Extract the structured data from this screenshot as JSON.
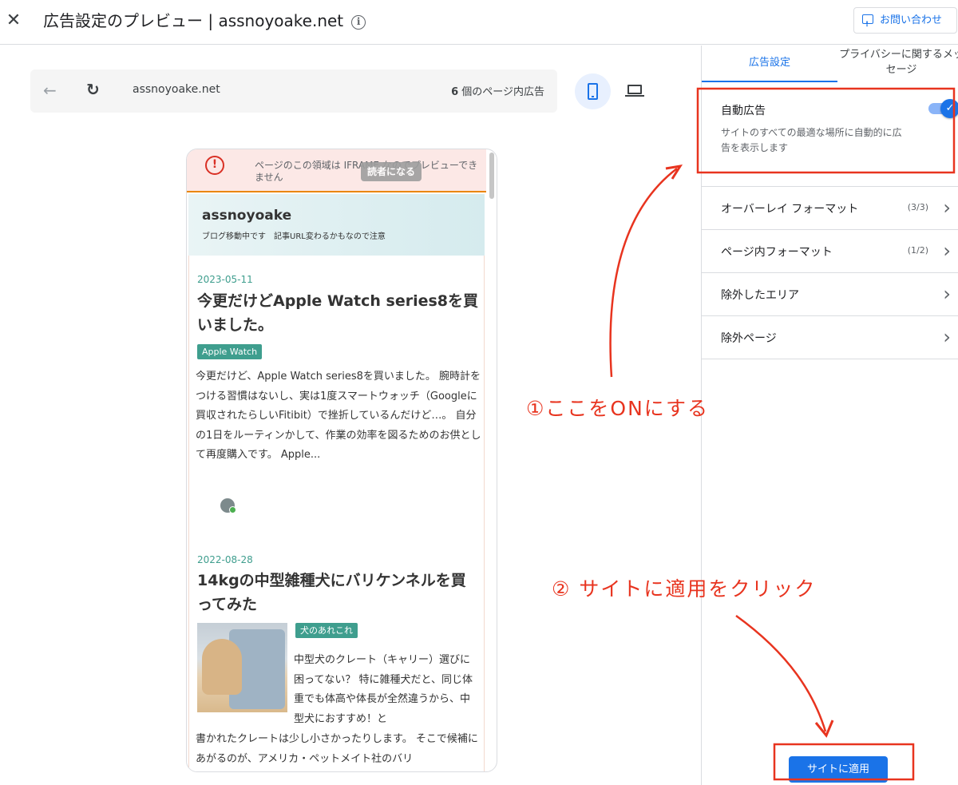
{
  "header": {
    "title": "広告設定のプレビュー | assnoyoake.net",
    "contact_label": "お問い合わせ"
  },
  "browser": {
    "url": "assnoyoake.net",
    "ad_count_number": "6",
    "ad_count_label": " 個のページ内広告"
  },
  "preview": {
    "iframe_message": "ページのこの領域は IFRAME なのでプレビューできません",
    "reader_button": "読者になる",
    "blog_name": "assnoyoake",
    "blog_description": "ブログ移動中です　記事URL変わるかもなので注意",
    "posts": [
      {
        "date": "2023-05-11",
        "title": "今更だけどApple Watch series8を買いました。",
        "tag": "Apple Watch",
        "excerpt": "今更だけど、Apple Watch series8を買いました。 腕時計をつける習慣はないし、実は1度スマートウォッチ（Googleに買収されたらしいFitibit）で挫折しているんだけど…。 自分の1日をルーティンかして、作業の効率を図るためのお供として再度購入です。 Apple..."
      },
      {
        "date": "2022-08-28",
        "title": "14kgの中型雑種犬にバリケンネルを買ってみた",
        "tag": "犬のあれこれ",
        "excerpt_side": "中型犬のクレート（キャリー）選びに困ってない？ 特に雑種犬だと、同じ体重でも体高や体長が全然違うから、中型犬におすすめ！と",
        "excerpt_below": "書かれたクレートは少し小さかったりします。 そこで候補にあがるのが、アメリカ・ペットメイト社のバリ"
      }
    ]
  },
  "sidebar": {
    "tab_ad_settings": "広告設定",
    "tab_privacy": "プライバシーに関するメッセージ",
    "auto_ads_title": "自動広告",
    "auto_ads_desc": "サイトのすべての最適な場所に自動的に広告を表示します",
    "auto_ads_enabled": true,
    "items": [
      {
        "label": "オーバーレイ フォーマット",
        "count": "(3/3)"
      },
      {
        "label": "ページ内フォーマット",
        "count": "(1/2)"
      },
      {
        "label": "除外したエリア",
        "count": ""
      },
      {
        "label": "除外ページ",
        "count": ""
      }
    ],
    "apply_button": "サイトに適用"
  },
  "annotations": {
    "step1": "①ここをONにする",
    "step2": "② サイトに適用をクリック",
    "color": "#e8341f"
  }
}
